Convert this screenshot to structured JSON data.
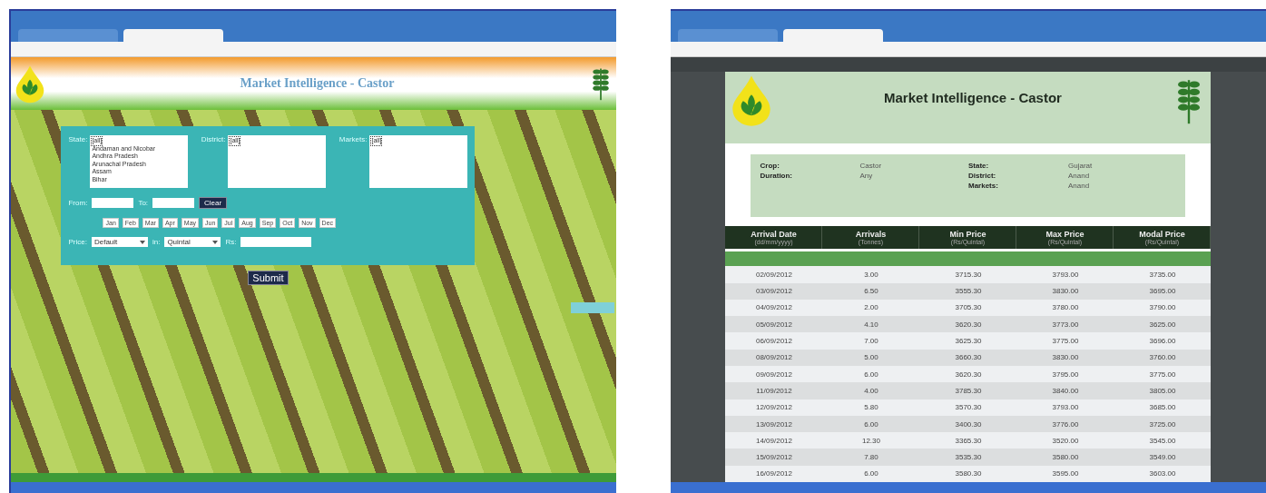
{
  "form_screen": {
    "banner_title": "Market Intelligence - Castor",
    "lists": [
      {
        "label": "State:",
        "options": [
          "[all]",
          "Andaman and Nicobar",
          "Andhra Pradesh",
          "Arunachal Pradesh",
          "Assam",
          "Bihar"
        ]
      },
      {
        "label": "District:",
        "options": [
          "[all]"
        ]
      },
      {
        "label": "Markets:",
        "options": [
          "[all]"
        ]
      }
    ],
    "from_label": "From:",
    "to_label": "To:",
    "clear_button": "Clear",
    "months": [
      "Jan",
      "Feb",
      "Mar",
      "Apr",
      "May",
      "Jun",
      "Jul",
      "Aug",
      "Sep",
      "Oct",
      "Nov",
      "Dec"
    ],
    "price_label": "Price:",
    "price_select": "Default",
    "in_label": "in:",
    "unit_select": "Quintal",
    "rs_label": "Rs:",
    "submit_button": "Submit"
  },
  "report_screen": {
    "title": "Market Intelligence - Castor",
    "info_left": [
      {
        "label": "Crop:",
        "value": "Castor"
      },
      {
        "label": "Duration:",
        "value": "Any"
      }
    ],
    "info_right": [
      {
        "label": "State:",
        "value": "Gujarat"
      },
      {
        "label": "District:",
        "value": "Anand"
      },
      {
        "label": "Markets:",
        "value": "Anand"
      }
    ],
    "columns": [
      {
        "title": "Arrival Date",
        "unit": "(dd/mm/yyyy)"
      },
      {
        "title": "Arrivals",
        "unit": "(Tonnes)"
      },
      {
        "title": "Min Price",
        "unit": "(Rs/Quintal)"
      },
      {
        "title": "Max Price",
        "unit": "(Rs/Quintal)"
      },
      {
        "title": "Modal Price",
        "unit": "(Rs/Quintal)"
      }
    ],
    "rows": [
      [
        "02/09/2012",
        "3.00",
        "3715.30",
        "3793.00",
        "3735.00"
      ],
      [
        "03/09/2012",
        "6.50",
        "3555.30",
        "3830.00",
        "3695.00"
      ],
      [
        "04/09/2012",
        "2.00",
        "3705.30",
        "3780.00",
        "3790.00"
      ],
      [
        "05/09/2012",
        "4.10",
        "3620.30",
        "3773.00",
        "3625.00"
      ],
      [
        "06/09/2012",
        "7.00",
        "3625.30",
        "3775.00",
        "3696.00"
      ],
      [
        "08/09/2012",
        "5.00",
        "3660.30",
        "3830.00",
        "3760.00"
      ],
      [
        "09/09/2012",
        "6.00",
        "3620.30",
        "3795.00",
        "3775.00"
      ],
      [
        "11/09/2012",
        "4.00",
        "3785.30",
        "3840.00",
        "3805.00"
      ],
      [
        "12/09/2012",
        "5.80",
        "3570.30",
        "3793.00",
        "3685.00"
      ],
      [
        "13/09/2012",
        "6.00",
        "3400.30",
        "3776.00",
        "3725.00"
      ],
      [
        "14/09/2012",
        "12.30",
        "3365.30",
        "3520.00",
        "3545.00"
      ],
      [
        "15/09/2012",
        "7.80",
        "3535.30",
        "3580.00",
        "3549.00"
      ],
      [
        "16/09/2012",
        "6.00",
        "3580.30",
        "3595.00",
        "3603.00"
      ]
    ]
  }
}
